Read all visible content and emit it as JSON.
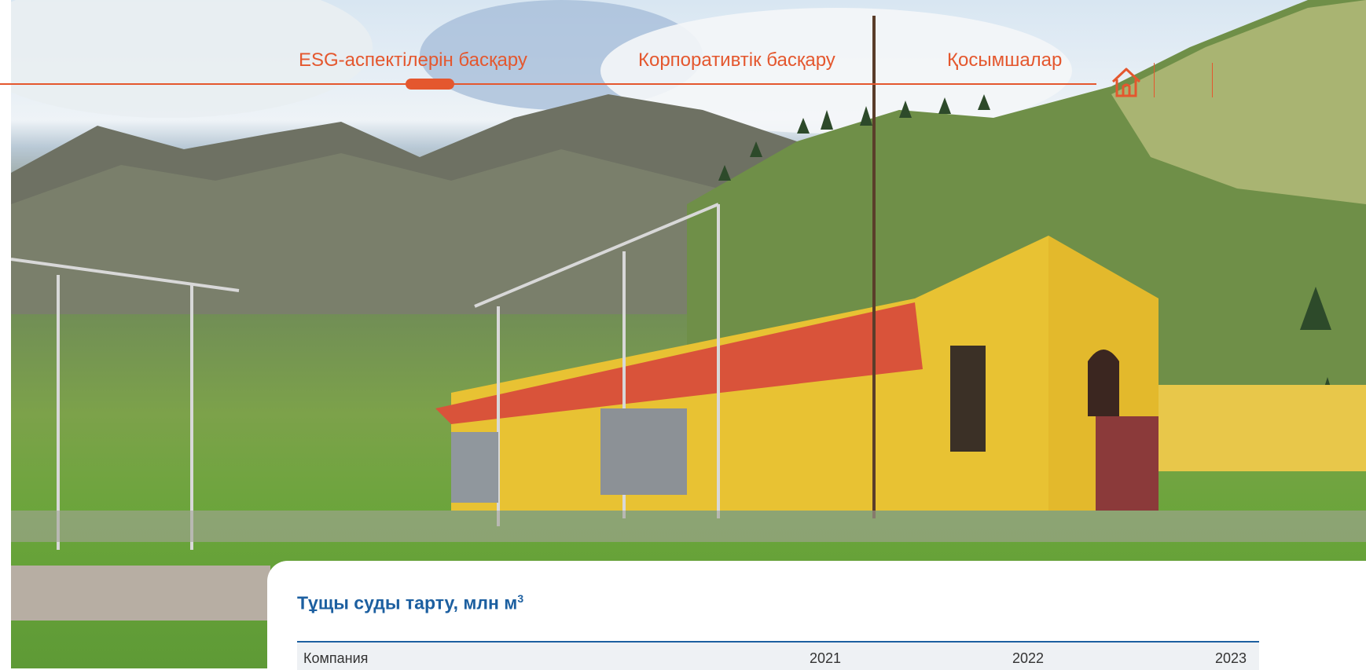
{
  "nav": {
    "items": [
      {
        "label": "ESG-аспектілерін басқару",
        "active": true
      },
      {
        "label": "Корпоративтік басқару",
        "active": false
      },
      {
        "label": "Қосымшалар",
        "active": false
      }
    ],
    "home_icon": "home-icon",
    "accent_color": "#e4572e"
  },
  "hero": {
    "description": "photo-background"
  },
  "table": {
    "title": "Тұщы суды тарту, млн м",
    "title_sup": "3",
    "columns": [
      "Компания",
      "2021",
      "2022",
      "2023"
    ],
    "title_color": "#1c5fa0"
  }
}
